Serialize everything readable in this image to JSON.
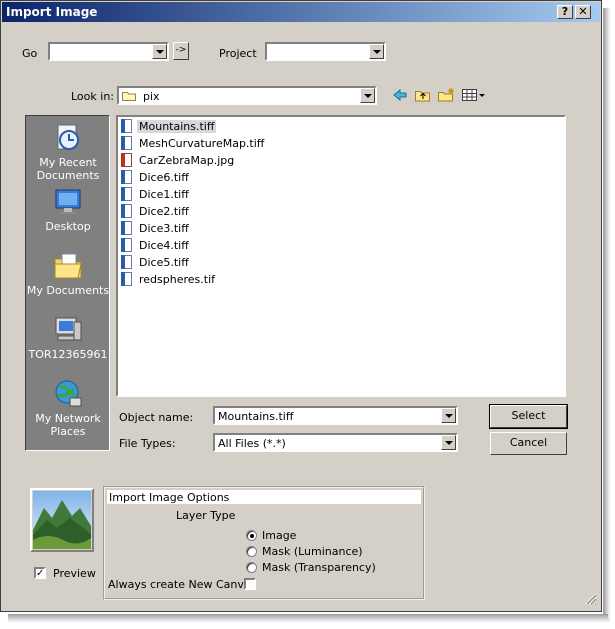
{
  "window": {
    "title": "Import Image",
    "help_label": "?",
    "close_label": "✕"
  },
  "top": {
    "go_label": "Go",
    "go_value": "",
    "go_arrow": "->",
    "project_label": "Project",
    "project_value": ""
  },
  "lookin": {
    "label": "Look in:",
    "value": "pix"
  },
  "sidebar": {
    "items": [
      {
        "label": "My Recent Documents",
        "icon": "recent-documents-icon"
      },
      {
        "label": "Desktop",
        "icon": "desktop-icon"
      },
      {
        "label": "My Documents",
        "icon": "my-documents-icon"
      },
      {
        "label": "TOR12365961",
        "icon": "computer-icon"
      },
      {
        "label": "My Network Places",
        "icon": "network-places-icon"
      }
    ]
  },
  "files": [
    {
      "name": "Mountains.tiff",
      "type": "tiff",
      "selected": true
    },
    {
      "name": "MeshCurvatureMap.tiff",
      "type": "tiff"
    },
    {
      "name": "CarZebraMap.jpg",
      "type": "jpg"
    },
    {
      "name": "Dice6.tiff",
      "type": "tiff"
    },
    {
      "name": "Dice1.tiff",
      "type": "tiff"
    },
    {
      "name": "Dice2.tiff",
      "type": "tiff"
    },
    {
      "name": "Dice3.tiff",
      "type": "tiff"
    },
    {
      "name": "Dice4.tiff",
      "type": "tiff"
    },
    {
      "name": "Dice5.tiff",
      "type": "tiff"
    },
    {
      "name": "redspheres.tif",
      "type": "tiff"
    }
  ],
  "object_name": {
    "label": "Object name:",
    "value": "Mountains.tiff"
  },
  "file_types": {
    "label": "File Types:",
    "value": "All Files (*.*)"
  },
  "buttons": {
    "select": "Select",
    "cancel": "Cancel"
  },
  "preview": {
    "label": "Preview",
    "checked": true
  },
  "options": {
    "title": "Import Image Options",
    "layer_type_label": "Layer Type",
    "layer_types": [
      {
        "label": "Image",
        "selected": true
      },
      {
        "label": "Mask (Luminance)",
        "selected": false
      },
      {
        "label": "Mask (Transparency)",
        "selected": false
      }
    ],
    "new_canvas_label": "Always create New Canvas",
    "new_canvas_checked": false
  },
  "colors": {
    "title_start": "#0a246a",
    "title_end": "#a6caf0",
    "dialog_bg": "#d4d0c8",
    "sidebar_bg": "#808080"
  }
}
